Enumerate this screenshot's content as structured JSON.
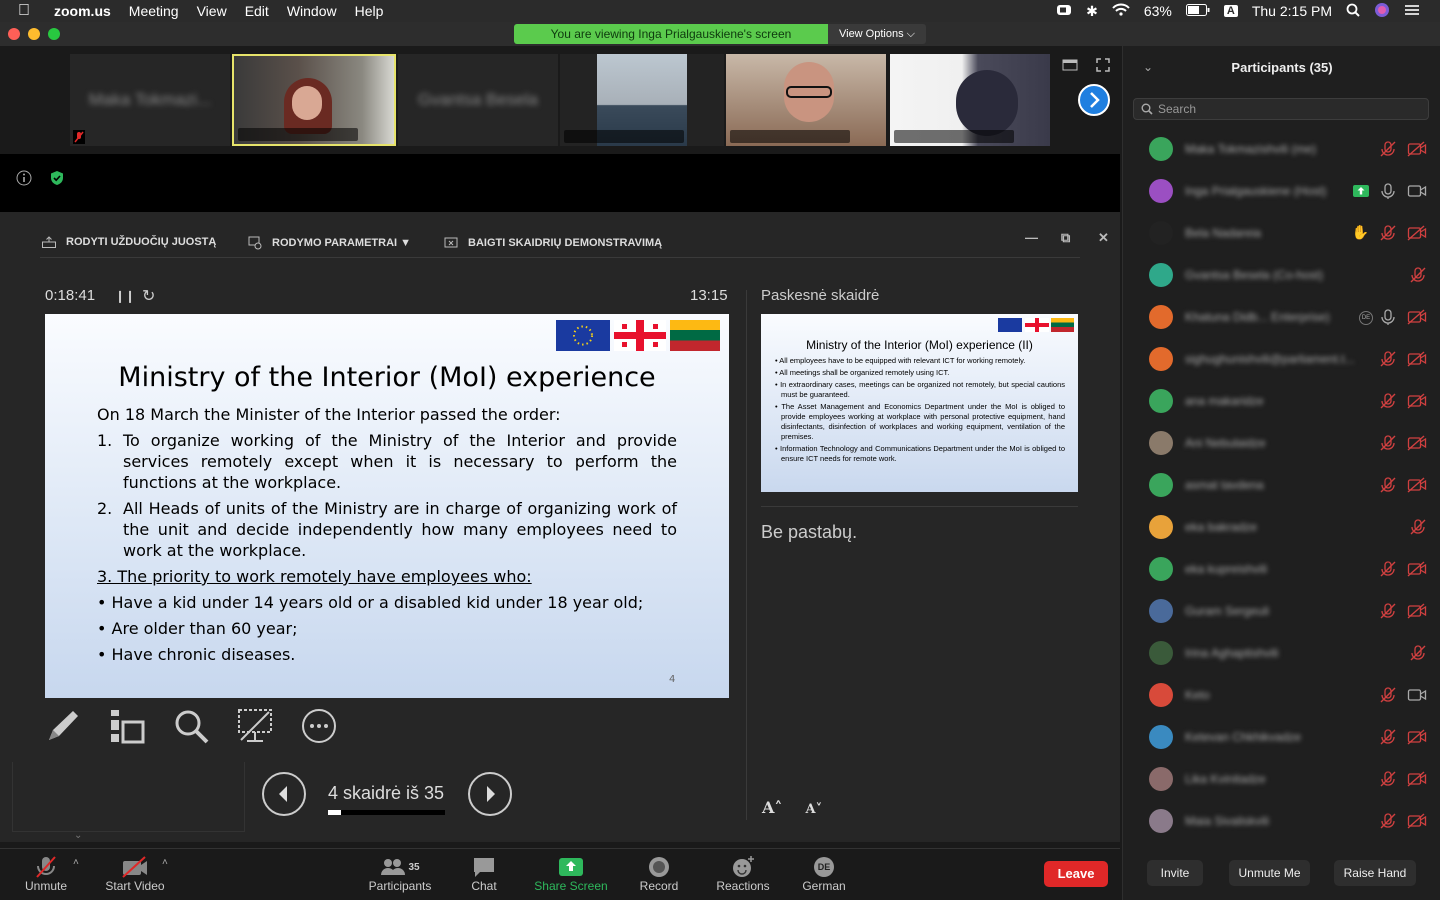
{
  "menubar": {
    "app": "zoom.us",
    "items": [
      "Meeting",
      "View",
      "Edit",
      "Window",
      "Help"
    ],
    "battery": "63%",
    "input": "A",
    "clock": "Thu 2:15 PM"
  },
  "banner": {
    "viewing": "You are viewing Inga Prialgauskiene's screen",
    "view_options": "View Options"
  },
  "ppt_toolbar": {
    "taskbar": "RODYTI UŽDUOČIŲ JUOSTĄ",
    "display": "RODYMO PARAMETRAI ▼",
    "end": "BAIGTI SKAIDRIŲ DEMONSTRAVIMĄ"
  },
  "presenter": {
    "timer": "0:18:41",
    "clock": "13:15",
    "next_label": "Paskesnė skaidrė",
    "notes": "Be pastabų.",
    "counter": "4 skaidrė iš 35",
    "progress": 0.11
  },
  "slide": {
    "title": "Ministry of the Interior (MoI) experience",
    "intro": "On 18 March the Minister of the Interior passed the order:",
    "item1_num": "1.",
    "item1": "To organize working of the Ministry of the Interior and provide services remotely except when it is necessary to perform the functions at the workplace.",
    "item2_num": "2.",
    "item2": "All Heads of units of the Ministry are in charge of organizing work of the unit and decide independently how many employees need to work at the workplace.",
    "item3": "3. The priority to work remotely have employees who:",
    "bullet1": "• Have a kid under 14 years old or a disabled kid under 18 year old;",
    "bullet2": "• Are older than 60 year;",
    "bullet3": "• Have chronic diseases.",
    "page": "4"
  },
  "next_slide": {
    "title": "Ministry of the Interior (MoI) experience (II)",
    "bullets": [
      "• All employees have to be equipped with relevant ICT for working remotely.",
      "• All meetings shall be organized remotely using ICT.",
      "• In extraordinary cases, meetings can be organized not remotely, but special cautions must be guaranteed.",
      "• The Asset Management and Economics Department under the MoI is obliged to provide employees working at workplace with personal protective equipment, hand disinfectants, disinfection of workplaces and working equipment, ventilation of the premises.",
      "• Information Technology and Communications Department under the MoI is obliged to ensure ICT needs for remote work."
    ]
  },
  "gallery": {
    "tile1": "Maka Tokmazi...",
    "tile3": "Gvantsa Besela"
  },
  "bottom_bar": {
    "unmute": "Unmute",
    "start_video": "Start Video",
    "participants": "Participants",
    "participants_count": "35",
    "chat": "Chat",
    "share": "Share Screen",
    "record": "Record",
    "reactions": "Reactions",
    "german": "German",
    "de_badge": "DE",
    "leave": "Leave"
  },
  "panel": {
    "title": "Participants (35)",
    "search_placeholder": "Search",
    "invite": "Invite",
    "unmute_me": "Unmute Me",
    "raise_hand": "Raise Hand",
    "rows": [
      {
        "name": "Maka Tokmazishvili (me)",
        "color": "#3aa55c",
        "ic1": "mic-off",
        "ic2": "video-off"
      },
      {
        "name": "Inga Prialgauskiene (Host)",
        "color": "#9b4fc2",
        "ic1": "mic-on",
        "ic2": "video-on",
        "share": true
      },
      {
        "name": "Bela Nadareia",
        "color": "#222222",
        "ic1": "mic-off",
        "ic2": "video-off",
        "hand": true
      },
      {
        "name": "Gvantsa Besela (Co-host)",
        "color": "#2fa88a",
        "ic1": "",
        "ic2": "mic-off"
      },
      {
        "name": "Khatuna Didb... Enterprise)",
        "color": "#e26a2c",
        "ic1": "mic-on",
        "ic2": "video-off",
        "de": true
      },
      {
        "name": "sighughunishvili@parliament.t...",
        "color": "#e26a2c",
        "ic1": "mic-off",
        "ic2": "video-off"
      },
      {
        "name": "ana makaridze",
        "color": "#3aa55c",
        "ic1": "mic-off",
        "ic2": "video-off"
      },
      {
        "name": "Ani Nebulaidze",
        "color": "#8a7a6a",
        "ic1": "mic-off",
        "ic2": "video-off"
      },
      {
        "name": "asmat tavdena",
        "color": "#3aa55c",
        "ic1": "mic-off",
        "ic2": "video-off"
      },
      {
        "name": "eka bakradze",
        "color": "#e8a23a",
        "ic1": "",
        "ic2": "mic-off"
      },
      {
        "name": "eka kupreishvili",
        "color": "#3aa55c",
        "ic1": "mic-off",
        "ic2": "video-off"
      },
      {
        "name": "Guram Sergeuli",
        "color": "#4a6a9a",
        "ic1": "mic-off",
        "ic2": "video-off"
      },
      {
        "name": "Irina Aghaptishvili",
        "color": "#3a5a3a",
        "ic1": "",
        "ic2": "mic-off"
      },
      {
        "name": "Keto",
        "color": "#d84a3a",
        "ic1": "mic-off",
        "ic2": "video-on"
      },
      {
        "name": "Ketevan Chkhikvadze",
        "color": "#3a8ac0",
        "ic1": "mic-off",
        "ic2": "video-off"
      },
      {
        "name": "Lika Kvinitadze",
        "color": "#8a6a6a",
        "ic1": "mic-off",
        "ic2": "video-off"
      },
      {
        "name": "Maia Sivaliskvili",
        "color": "#8a7a8a",
        "ic1": "mic-off",
        "ic2": "video-off"
      }
    ]
  }
}
